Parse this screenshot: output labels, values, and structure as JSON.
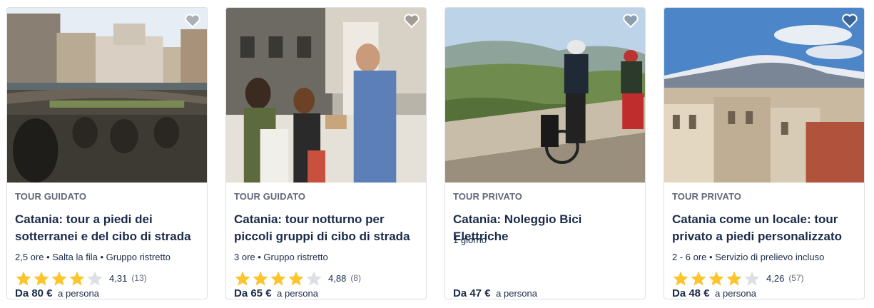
{
  "colors": {
    "text": "#1a2b49",
    "muted": "#63687a",
    "star_filled": "#fdc52c",
    "star_empty": "#dcdfe4",
    "border": "#dcdfe4"
  },
  "cards": [
    {
      "category": "TOUR GUIDATO",
      "title": "Catania: tour a piedi dei sotterranei e del cibo di strada",
      "meta": "2,5 ore • Salta la fila • Gruppo ristretto",
      "rating": 4.31,
      "rating_text": "4,31",
      "reviews": "(13)",
      "price_amount": "Da 80 €",
      "price_unit": "a persona",
      "image": "roman-amphitheatre-and-baroque-church"
    },
    {
      "category": "TOUR GUIDATO",
      "title": "Catania: tour notturno per piccoli gruppi di cibo di strada",
      "meta": "3 ore • Gruppo ristretto",
      "rating": 4.88,
      "rating_text": "4,88",
      "reviews": "(8)",
      "price_amount": "Da 65 €",
      "price_unit": "a persona",
      "image": "people-tasting-street-food"
    },
    {
      "category": "TOUR PRIVATO",
      "title": "Catania: Noleggio Bici Elettriche",
      "meta": "1 giorno",
      "rating": null,
      "price_amount": "Da 47 €",
      "price_unit": "a persona",
      "image": "cyclists-on-hilltop"
    },
    {
      "category": "TOUR PRIVATO",
      "title": "Catania come un locale: tour privato a piedi personalizzato",
      "meta": "2 - 6 ore • Servizio di prelievo incluso",
      "rating": 4.26,
      "rating_text": "4,26",
      "reviews": "(57)",
      "price_amount": "Da 48 €",
      "price_unit": "a persona",
      "image": "city-rooftops-and-etna"
    }
  ]
}
